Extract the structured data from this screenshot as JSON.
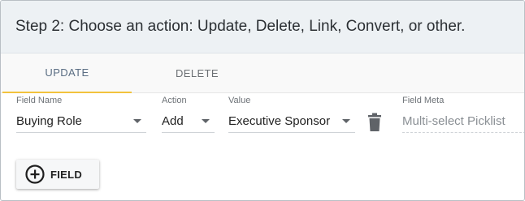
{
  "header": {
    "title": "Step 2: Choose an action: Update, Delete, Link, Convert, or other."
  },
  "tabs": [
    {
      "label": "UPDATE",
      "active": true
    },
    {
      "label": "DELETE",
      "active": false
    }
  ],
  "row": {
    "field_name_label": "Field Name",
    "field_name_value": "Buying Role",
    "action_label": "Action",
    "action_value": "Add",
    "value_label": "Value",
    "value_value": "Executive Sponsor",
    "field_meta_label": "Field Meta",
    "field_meta_placeholder": "Multi-select Picklist"
  },
  "add_button": {
    "label": "FIELD",
    "icon": "plus-circle-icon"
  },
  "colors": {
    "active_tab_underline": "#f2c33c",
    "header_bg": "#edf1f4"
  }
}
